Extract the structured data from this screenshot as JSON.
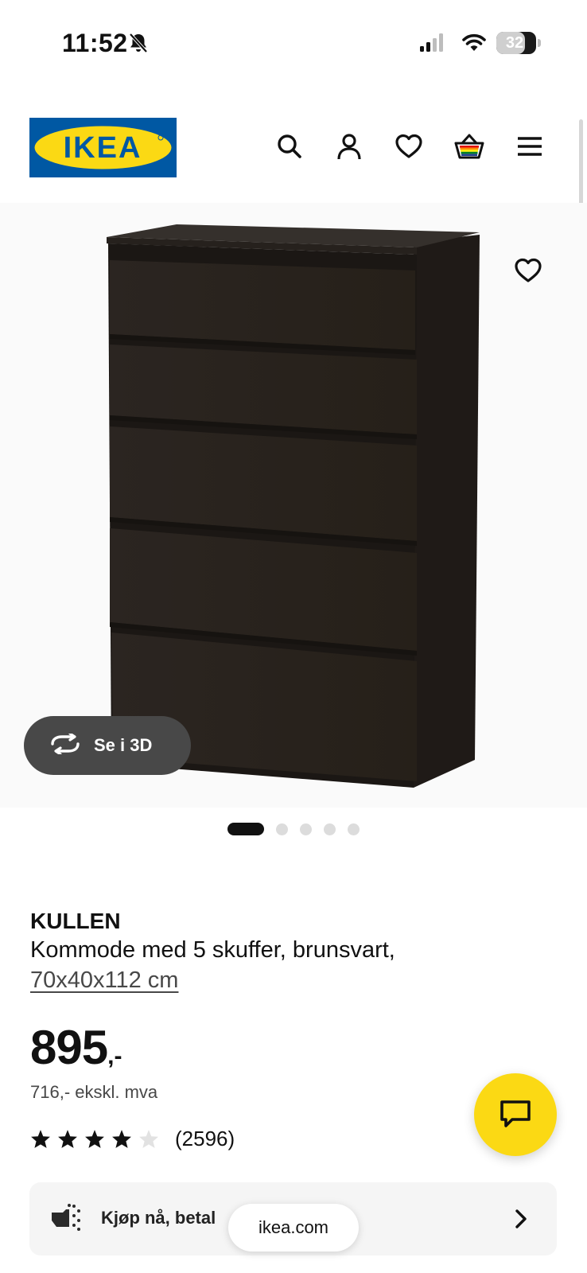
{
  "status_bar": {
    "time": "11:52",
    "battery": "32"
  },
  "header": {
    "logo_text": "IKEA",
    "icons": [
      "search-icon",
      "account-icon",
      "heart-icon",
      "cart-icon",
      "menu-icon"
    ]
  },
  "gallery": {
    "view_3d_label": "Se i 3D",
    "dot_count": 5,
    "active_dot": 0
  },
  "product": {
    "name": "KULLEN",
    "description": "Kommode med 5 skuffer, brunsvart,",
    "dimensions": "70x40x112 cm",
    "price": "895",
    "price_suffix": ",-",
    "price_ex_vat": "716,- ekskl. mva",
    "rating": 4,
    "rating_max": 5,
    "review_count": "(2596)"
  },
  "finance": {
    "label": "Kjøp nå, betal"
  },
  "browser": {
    "url": "ikea.com"
  },
  "colors": {
    "ikea_blue": "#0058a3",
    "ikea_yellow": "#fbd914",
    "chest_color": "#2a2420"
  }
}
